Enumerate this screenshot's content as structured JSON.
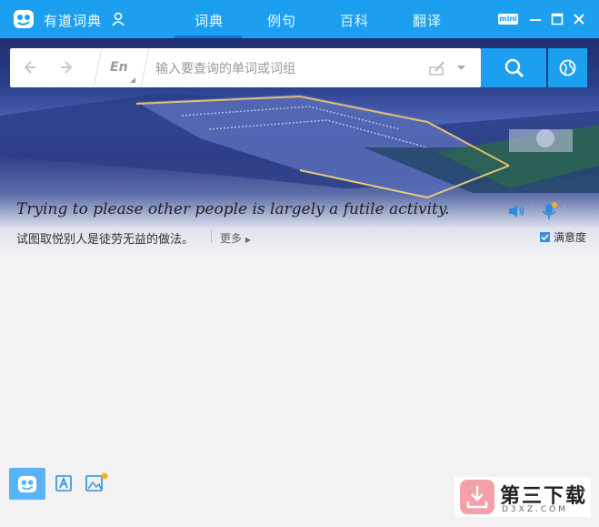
{
  "app": {
    "title": "有道词典"
  },
  "tabs": [
    {
      "label": "词典",
      "active": true
    },
    {
      "label": "例句",
      "active": false
    },
    {
      "label": "百科",
      "active": false
    },
    {
      "label": "翻译",
      "active": false
    }
  ],
  "window": {
    "mini_label": "mini"
  },
  "search": {
    "lang_label": "En",
    "placeholder": "输入要查询的单词或词组",
    "value": ""
  },
  "daily": {
    "sentence_en": "Trying to please other people is largely a futile activity.",
    "sentence_zh": "试图取悦别人是徒劳无益的做法。",
    "more_label": "更多",
    "satisfaction_label": "满意度",
    "satisfaction_checked": true
  },
  "watermark": {
    "title": "第三下载",
    "subtitle": "D3XZ.COM"
  },
  "colors": {
    "brand": "#1d9ff0",
    "notify_dot": "#f5b21a"
  }
}
